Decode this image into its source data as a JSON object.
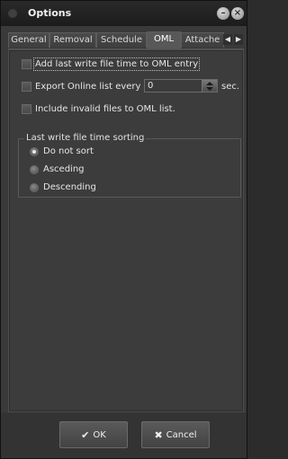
{
  "window": {
    "title": "Options"
  },
  "tabs": [
    {
      "label": "General"
    },
    {
      "label": "Removal"
    },
    {
      "label": "Schedule"
    },
    {
      "label": "OML",
      "active": true
    },
    {
      "label": "Attache"
    }
  ],
  "oml": {
    "add_last_write": {
      "label": "Add last write file time to OML entry",
      "checked": false
    },
    "export_online": {
      "label": "Export Online list every",
      "checked": false,
      "value": "0",
      "unit": "sec."
    },
    "include_invalid": {
      "label": "Include invalid files to OML list.",
      "checked": false
    },
    "sorting": {
      "title": "Last write file time sorting",
      "options": [
        {
          "label": "Do not sort",
          "selected": true
        },
        {
          "label": "Asceding",
          "selected": false
        },
        {
          "label": "Descending",
          "selected": false
        }
      ]
    }
  },
  "buttons": {
    "ok": "OK",
    "cancel": "Cancel"
  },
  "icons": {
    "minimize": "minimize-icon",
    "close": "close-icon",
    "tab_left": "arrow-left-icon",
    "tab_right": "arrow-right-icon",
    "ok": "checkmark-icon",
    "cancel": "x-icon"
  }
}
